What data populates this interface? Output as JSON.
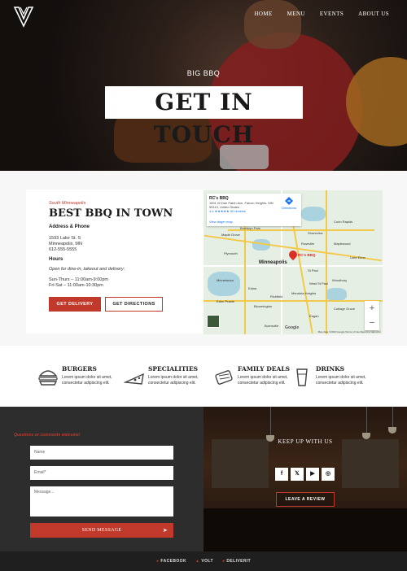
{
  "nav": {
    "items": [
      "HOME",
      "MENU",
      "EVENTS",
      "ABOUT US"
    ]
  },
  "hero": {
    "eyebrow": "BIG BBQ",
    "title": "GET IN TOUCH"
  },
  "location": {
    "tag": "South Minneapolis",
    "title": "BEST BBQ IN TOWN",
    "address_label": "Address & Phone",
    "address_lines": [
      "1593 Lake St. S",
      "Minneapolis, MN",
      "612-555-5555"
    ],
    "hours_label": "Hours",
    "hours_note": "Open for dine-in, takeout and delivery:",
    "hours_lines": [
      "Sun-Thurs – 11:00am-9:00pm",
      "Fri-Sat – 11:00am-10:30pm"
    ],
    "delivery_button": "GET DELIVERY",
    "directions_button": "GET DIRECTIONS"
  },
  "map": {
    "place_name": "RC's BBQ",
    "address": "1501 W Dan Patch Ave, Falcon Heights, MN 55113, United States",
    "rating": "4.4 ★★★★★",
    "reviews": "52 reviews",
    "directions": "Directions",
    "larger": "View larger map",
    "pin_label": "RC's BBQ",
    "city_big": "Minneapolis",
    "cities": [
      "Brooklyn Park",
      "Maple Grove",
      "Plymouth",
      "Minnetonka",
      "Edina",
      "Eden Prairie",
      "Bloomington",
      "Burnsville",
      "Eagan",
      "Woodbury",
      "St Paul",
      "Roseville",
      "Shoreview",
      "Blaine",
      "Lake Elmo",
      "Cottage Grove",
      "Richfield",
      "West St Paul",
      "Mendota Heights",
      "Maplewood",
      "Coon Rapids"
    ],
    "zoom_in": "+",
    "zoom_out": "−",
    "google": "Google",
    "footer": "Map data ©2023 Google   Terms of Use   Report a map error"
  },
  "specialties": [
    {
      "icon": "burger-icon",
      "title": "BURGERS",
      "desc": "Lorem ipsum dolor sit amet, consectetur adipiscing elit."
    },
    {
      "icon": "pizza-slice-icon",
      "title": "SPECIALITIES",
      "desc": "Lorem ipsum dolor sit amet, consectetur adipiscing elit."
    },
    {
      "icon": "family-deal-icon",
      "title": "FAMILY DEALS",
      "desc": "Lorem ipsum dolor sit amet, consectetur adipiscing elit."
    },
    {
      "icon": "drink-glass-icon",
      "title": "DRINKS",
      "desc": "Lorem ipsum dolor sit amet, consectetur adipiscing elit."
    }
  ],
  "form": {
    "prompt": "Questions or comments welcome!",
    "name_placeholder": "Name",
    "email_placeholder": "Email*",
    "message_placeholder": "Message...",
    "send_label": "SEND MESSAGE"
  },
  "social": {
    "title": "KEEP UP WITH US",
    "review_button": "LEAVE A REVIEW"
  },
  "footer": {
    "links": [
      "FACEBOOK",
      "VOLT",
      "DELIVERIT"
    ]
  },
  "colors": {
    "accent": "#c0392b",
    "dark": "#2d2d2d"
  }
}
